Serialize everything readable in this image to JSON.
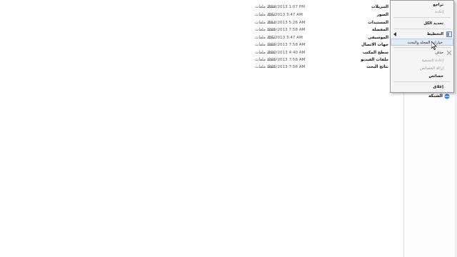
{
  "file_list": {
    "rows": [
      {
        "name": "التنزيلات",
        "date": "2/19/2013 1:07 PM",
        "type": "مجلد ملفات"
      },
      {
        "name": "الصور",
        "date": "2/7/2013 3:47 AM",
        "type": "مجلد ملفات"
      },
      {
        "name": "المستندات",
        "date": "2/13/2013 5:26 AM",
        "type": "مجلد ملفات"
      },
      {
        "name": "المفضلة",
        "date": "1/25/2013 7:58 AM",
        "type": "مجلد ملفات"
      },
      {
        "name": "الموسيقى",
        "date": "2/7/2013 3:47 AM",
        "type": "مجلد ملفات"
      },
      {
        "name": "جهات الاتصال",
        "date": "1/25/2013 7:58 AM",
        "type": "مجلد ملفات"
      },
      {
        "name": "سطح المكتب",
        "date": "2/20/2013 4:40 AM",
        "type": "مجلد ملفات"
      },
      {
        "name": "ملفات الفيديو",
        "date": "1/25/2013 7:58 AM",
        "type": "مجلد ملفات"
      },
      {
        "name": "نتائج البحث",
        "date": "1/25/2013 7:58 AM",
        "type": "مجلد ملفات"
      }
    ]
  },
  "context_menu": {
    "items": [
      {
        "label": "تراجع",
        "style": "bold"
      },
      {
        "label": "إعادة",
        "style": "disabled"
      },
      {
        "label": "تحديد الكل",
        "style": "bold"
      },
      {
        "label": "التخطيط",
        "style": "bold",
        "submenu": true
      },
      {
        "label": "خيارات المجلد والبحث",
        "style": "highlight"
      },
      {
        "label": "حذف",
        "style": "normal"
      },
      {
        "label": "إعادة التسمية",
        "style": "disabled"
      },
      {
        "label": "إزالة الخصائص",
        "style": "disabled"
      },
      {
        "label": "خصائص",
        "style": "bold"
      },
      {
        "label": "إغلاق",
        "style": "bold"
      }
    ]
  },
  "nav_pane": {
    "network_label": "الشبكة"
  },
  "colors": {
    "menu_highlight": "#e2ecf8",
    "network_icon": "#2a7bd3"
  }
}
